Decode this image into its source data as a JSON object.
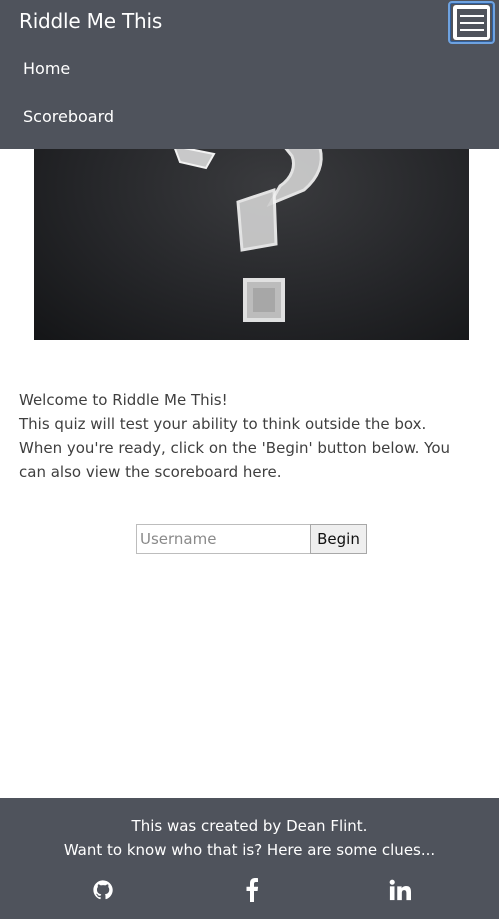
{
  "navbar": {
    "brand": "Riddle Me This",
    "links": [
      {
        "label": "Home"
      },
      {
        "label": "Scoreboard"
      }
    ],
    "toggler_icon": "hamburger-icon"
  },
  "hero": {
    "icon": "question-mark-chalkboard"
  },
  "intro": {
    "line1": "Welcome to Riddle Me This!",
    "line2": "This quiz will test your ability to think outside the box.",
    "line3": "When you're ready, click on the 'Begin' button below. You can also view the scoreboard here."
  },
  "form": {
    "username_placeholder": "Username",
    "username_value": "",
    "begin_label": "Begin"
  },
  "footer": {
    "line1": "This was created by Dean Flint.",
    "line2": "Want to know who that is? Here are some clues...",
    "social": [
      "github-icon",
      "facebook-icon",
      "linkedin-icon"
    ]
  }
}
